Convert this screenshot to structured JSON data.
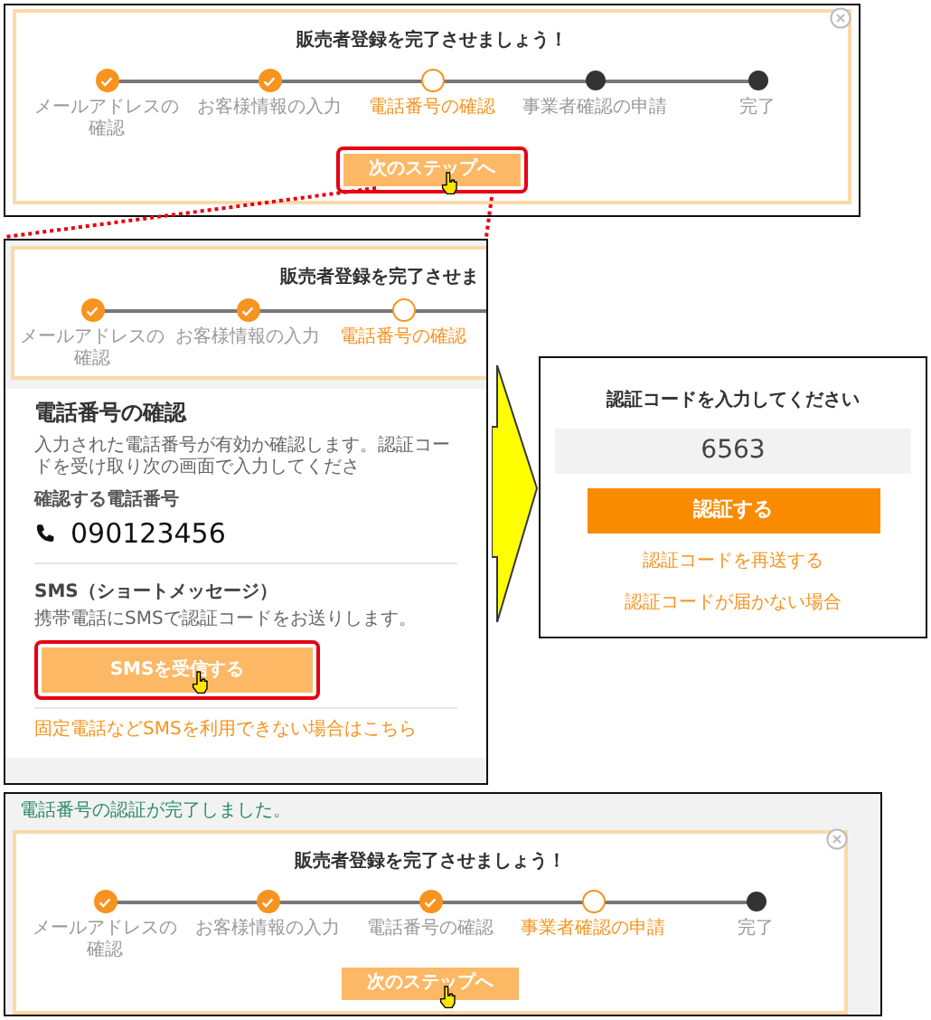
{
  "guide_top": {
    "title": "販売者登録を完了させましょう！",
    "steps": [
      {
        "label": "メールアドレスの確認",
        "done": true,
        "current": false
      },
      {
        "label": "お客様情報の入力",
        "done": true,
        "current": false
      },
      {
        "label": "電話番号の確認",
        "done": false,
        "current": true
      },
      {
        "label": "事業者確認の申請",
        "done": false,
        "current": false
      },
      {
        "label": "完了",
        "done": false,
        "current": false
      }
    ],
    "button": {
      "label": "次のステップへ",
      "highlighted": true
    }
  },
  "phone_screen": {
    "progress": {
      "title": "販売者登録を完了させま",
      "cut": true,
      "steps": [
        {
          "label": "メールアドレスの確認",
          "done": true,
          "current": false
        },
        {
          "label": "お客様情報の入力",
          "done": true,
          "current": false
        },
        {
          "label": "電話番号の確認",
          "done": false,
          "current": true
        }
      ]
    },
    "heading": "電話番号の確認",
    "description": "入力された電話番号が有効か確認します。認証コードを受け取り次の画面で入力してくださ",
    "phone_label": "確認する電話番号",
    "phone_number": "090123456",
    "sms_heading": "SMS（ショートメッセージ）",
    "sms_description": "携帯電話にSMSで認証コードをお送りします。",
    "sms_button": {
      "label": "SMSを受信する",
      "highlighted": true
    },
    "alt_link": "固定電話などSMSを利用できない場合はこちら"
  },
  "code_dialog": {
    "title": "認証コードを入力してください",
    "code": "6563",
    "verify_button": "認証する",
    "links": [
      "認証コードを再送する",
      "認証コードが届かない場合"
    ]
  },
  "result_screen": {
    "notice": "電話番号の認証が完了しました。",
    "title": "販売者登録を完了させましょう！",
    "steps": [
      {
        "label": "メールアドレスの確認",
        "done": true,
        "current": false
      },
      {
        "label": "お客様情報の入力",
        "done": true,
        "current": false
      },
      {
        "label": "電話番号の確認",
        "done": true,
        "current": false
      },
      {
        "label": "事業者確認の申請",
        "done": false,
        "current": true
      },
      {
        "label": "完了",
        "done": false,
        "current": false
      }
    ],
    "button": {
      "label": "次のステップへ",
      "highlighted": false
    }
  }
}
